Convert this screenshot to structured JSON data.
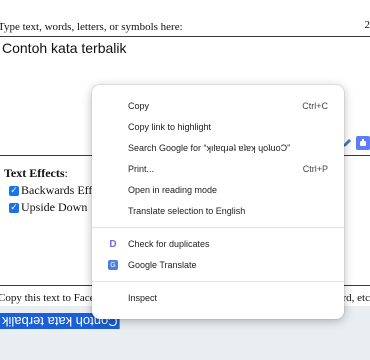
{
  "page": {
    "input_label": "Type text, words, letters, or symbols here:",
    "counter": "2",
    "input_text": "Contoh kata terbalik",
    "effects_title": "Text Effects",
    "effects_colon": ":",
    "options": [
      {
        "label": "Backwards Eff",
        "checked": true
      },
      {
        "label": "Upside Down ",
        "checked": true
      }
    ],
    "copy_instruction": "Copy this text to Faceb",
    "copy_instruction_right": "rd, etc",
    "output_text": "Contoh kata terbalik"
  },
  "context_menu": {
    "items": [
      {
        "label": "Copy",
        "shortcut": "Ctrl+C"
      },
      {
        "label": "Copy link to highlight",
        "shortcut": ""
      },
      {
        "label": "Search Google for “ʞılɐqɹǝʇ ɐʇɐʞ ɥoʇuoƆ”",
        "shortcut": ""
      },
      {
        "label": "Print...",
        "shortcut": "Ctrl+P"
      },
      {
        "label": "Open in reading mode",
        "shortcut": ""
      },
      {
        "label": "Translate selection to English",
        "shortcut": ""
      }
    ],
    "extension_items": [
      {
        "label": "Check for duplicates",
        "icon": "d-extension-icon"
      },
      {
        "label": "Google Translate",
        "icon": "google-translate-icon"
      }
    ],
    "inspect": "Inspect"
  }
}
